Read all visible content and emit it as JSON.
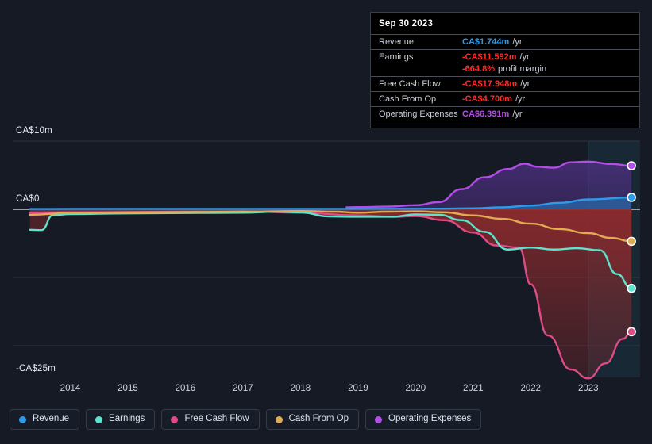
{
  "chart_data": {
    "type": "area",
    "title": "",
    "xlabel": "",
    "ylabel": "",
    "currency": "CA$",
    "ylim": [
      -25,
      10
    ],
    "ytick_labels": [
      "CA$10m",
      "CA$0",
      "-CA$25m"
    ],
    "ytick_values": [
      10,
      0,
      -25
    ],
    "gridlines": [
      10,
      0,
      -10,
      -20
    ],
    "xlim": [
      2013.0,
      2023.9
    ],
    "categories": [
      "2014",
      "2015",
      "2016",
      "2017",
      "2018",
      "2019",
      "2020",
      "2021",
      "2022",
      "2023"
    ],
    "legend_position": "bottom",
    "grid": true,
    "forecast_region_start": "2023.0",
    "series": [
      {
        "name": "Revenue",
        "color": "#2e9bea",
        "fill": "#1d4f7d",
        "x": [
          2013.3,
          2014.0,
          2015.0,
          2016.0,
          2017.0,
          2018.0,
          2019.0,
          2020.0,
          2020.5,
          2021.0,
          2021.5,
          2022.0,
          2022.5,
          2023.0,
          2023.75
        ],
        "values": [
          0.05,
          0.06,
          0.06,
          0.07,
          0.06,
          0.06,
          0.07,
          0.08,
          0.1,
          0.15,
          0.3,
          0.55,
          0.95,
          1.45,
          1.744
        ],
        "endpoint_value": "CA$1.744m"
      },
      {
        "name": "Earnings",
        "color": "#5fe3cd",
        "fill": "#7e2630",
        "x": [
          2013.3,
          2013.5,
          2013.7,
          2014.0,
          2015.0,
          2016.0,
          2017.0,
          2017.6,
          2018.0,
          2018.5,
          2019.0,
          2019.6,
          2020.0,
          2020.4,
          2020.8,
          2021.2,
          2021.6,
          2022.0,
          2022.4,
          2022.8,
          2023.2,
          2023.5,
          2023.75
        ],
        "values": [
          -3.0,
          -3.05,
          -0.85,
          -0.7,
          -0.6,
          -0.55,
          -0.5,
          -0.35,
          -0.45,
          -1.05,
          -1.1,
          -1.1,
          -0.75,
          -0.8,
          -1.6,
          -3.3,
          -5.9,
          -5.6,
          -5.9,
          -5.7,
          -6.0,
          -9.5,
          -11.592
        ],
        "endpoint_value": "-CA$11.592m"
      },
      {
        "name": "Free Cash Flow",
        "color": "#df4b85",
        "fill": "#7e2630",
        "x": [
          2013.3,
          2014.0,
          2015.0,
          2016.0,
          2017.0,
          2018.0,
          2019.0,
          2019.6,
          2020.0,
          2020.5,
          2021.0,
          2021.4,
          2021.8,
          2022.0,
          2022.3,
          2022.7,
          2023.0,
          2023.3,
          2023.6,
          2023.75
        ],
        "values": [
          -0.5,
          -0.45,
          -0.4,
          -0.35,
          -0.3,
          -0.5,
          -0.9,
          -1.1,
          -1.0,
          -1.6,
          -3.4,
          -5.3,
          -5.6,
          -11.0,
          -18.5,
          -23.5,
          -24.8,
          -22.6,
          -19.0,
          -17.948
        ],
        "endpoint_value": "-CA$17.948m"
      },
      {
        "name": "Cash From Op",
        "color": "#e2ab51",
        "fill": "#7e2630",
        "x": [
          2013.3,
          2014.0,
          2015.0,
          2016.0,
          2017.0,
          2018.0,
          2018.6,
          2019.0,
          2019.5,
          2020.0,
          2020.5,
          2021.0,
          2021.5,
          2022.0,
          2022.5,
          2023.0,
          2023.4,
          2023.75
        ],
        "values": [
          -0.8,
          -0.55,
          -0.45,
          -0.4,
          -0.35,
          -0.25,
          -0.35,
          -0.5,
          -0.35,
          -0.3,
          -0.45,
          -0.9,
          -1.4,
          -2.1,
          -2.9,
          -3.5,
          -4.2,
          -4.7
        ],
        "endpoint_value": "-CA$4.700m"
      },
      {
        "name": "Operating Expenses",
        "color": "#b44ce8",
        "fill": "#3c2a63",
        "x": [
          2018.8,
          2019.0,
          2019.5,
          2020.0,
          2020.4,
          2020.8,
          2021.2,
          2021.6,
          2021.9,
          2022.1,
          2022.4,
          2022.7,
          2023.0,
          2023.4,
          2023.75
        ],
        "values": [
          0.3,
          0.32,
          0.4,
          0.6,
          1.05,
          2.95,
          4.7,
          5.9,
          6.7,
          6.25,
          6.1,
          6.9,
          7.0,
          6.65,
          6.391
        ],
        "endpoint_value": "CA$6.391m"
      }
    ]
  },
  "yaxis": {
    "top": "CA$10m",
    "zero": "CA$0",
    "bottom": "-CA$25m"
  },
  "xaxis": {
    "ticks": [
      "2014",
      "2015",
      "2016",
      "2017",
      "2018",
      "2019",
      "2020",
      "2021",
      "2022",
      "2023"
    ]
  },
  "tooltip": {
    "date": "Sep 30 2023",
    "rows": [
      {
        "label": "Revenue",
        "value": "CA$1.744m",
        "suffix": "/yr",
        "color": "#2e9bea"
      },
      {
        "label": "Earnings",
        "value": "-CA$11.592m",
        "suffix": "/yr",
        "color": "#ff2b2b"
      },
      {
        "label": "",
        "value": "-664.8%",
        "suffix": "profit margin",
        "color": "#ff2b2b"
      },
      {
        "label": "Free Cash Flow",
        "value": "-CA$17.948m",
        "suffix": "/yr",
        "color": "#ff2b2b"
      },
      {
        "label": "Cash From Op",
        "value": "-CA$4.700m",
        "suffix": "/yr",
        "color": "#ff2b2b"
      },
      {
        "label": "Operating Expenses",
        "value": "CA$6.391m",
        "suffix": "/yr",
        "color": "#b44ce8"
      }
    ]
  },
  "legend": {
    "items": [
      {
        "label": "Revenue",
        "color": "#2e9bea"
      },
      {
        "label": "Earnings",
        "color": "#5fe3cd"
      },
      {
        "label": "Free Cash Flow",
        "color": "#df4b85"
      },
      {
        "label": "Cash From Op",
        "color": "#e2ab51"
      },
      {
        "label": "Operating Expenses",
        "color": "#b44ce8"
      }
    ]
  }
}
